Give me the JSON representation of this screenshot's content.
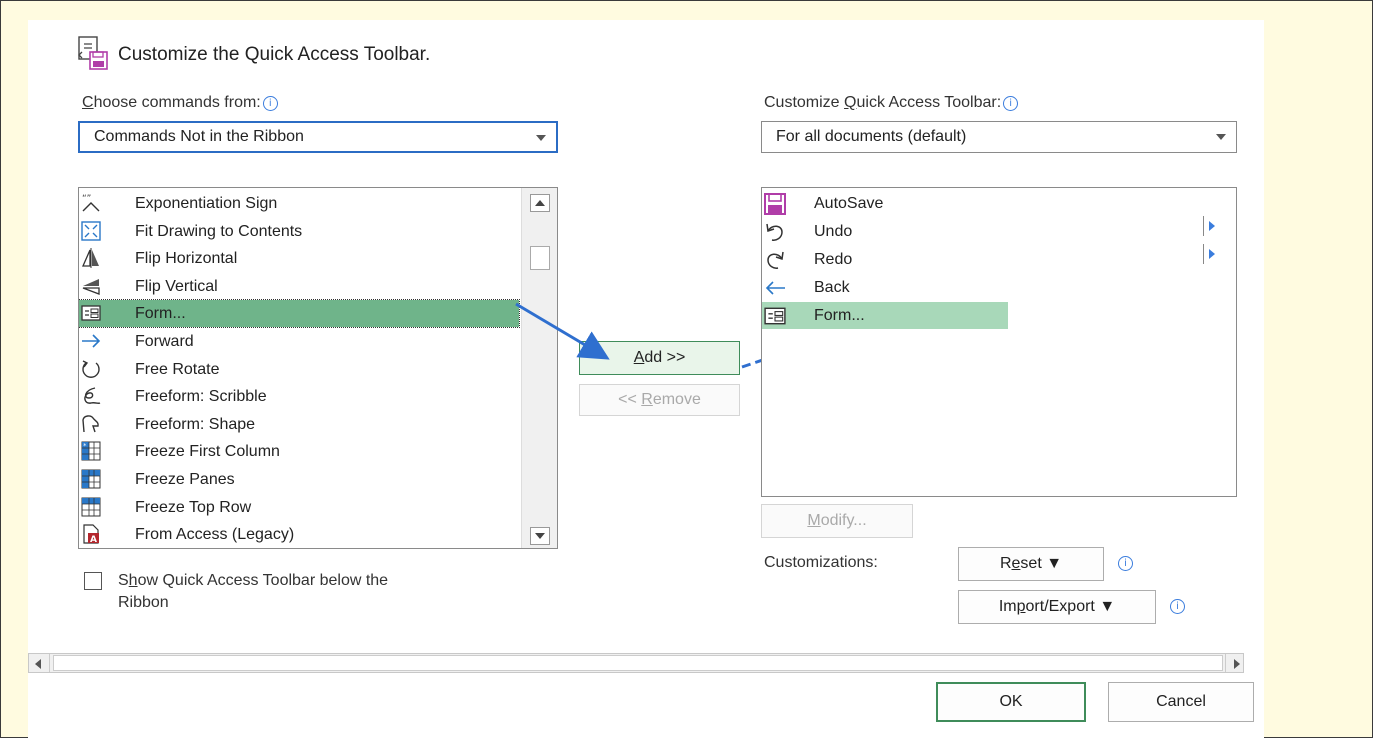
{
  "title": "Customize the Quick Access Toolbar.",
  "left": {
    "label_pre": "",
    "label_u": "C",
    "label_post": "hoose commands from:",
    "dropdown_value": "Commands Not in the Ribbon",
    "items": [
      {
        "label": "Exponentiation Sign",
        "icon": "exponent-icon"
      },
      {
        "label": "Fit Drawing to Contents",
        "icon": "fit-drawing-icon"
      },
      {
        "label": "Flip Horizontal",
        "icon": "flip-horizontal-icon"
      },
      {
        "label": "Flip Vertical",
        "icon": "flip-vertical-icon"
      },
      {
        "label": "Form...",
        "icon": "form-icon"
      },
      {
        "label": "Forward",
        "icon": "forward-arrow-icon"
      },
      {
        "label": "Free Rotate",
        "icon": "rotate-icon"
      },
      {
        "label": "Freeform: Scribble",
        "icon": "scribble-icon"
      },
      {
        "label": "Freeform: Shape",
        "icon": "freeform-shape-icon"
      },
      {
        "label": "Freeze First Column",
        "icon": "freeze-column-icon"
      },
      {
        "label": "Freeze Panes",
        "icon": "freeze-panes-icon"
      },
      {
        "label": "Freeze Top Row",
        "icon": "freeze-row-icon"
      },
      {
        "label": "From Access (Legacy)",
        "icon": "access-icon"
      }
    ],
    "selected_index": 4,
    "checkbox_line1_pre": "S",
    "checkbox_line1_u": "h",
    "checkbox_line1_post": "ow Quick Access Toolbar below the",
    "checkbox_line2": "Ribbon"
  },
  "middle": {
    "add_u": "A",
    "add_post": "dd >>",
    "remove_pre": "<< ",
    "remove_u": "R",
    "remove_post": "emove"
  },
  "right": {
    "label_pre": "Customize ",
    "label_u": "Q",
    "label_post": "uick Access Toolbar:",
    "dropdown_value": "For all documents (default)",
    "items": [
      {
        "label": "AutoSave",
        "icon": "save-icon"
      },
      {
        "label": "Undo",
        "icon": "undo-icon"
      },
      {
        "label": "Redo",
        "icon": "redo-icon"
      },
      {
        "label": "Back",
        "icon": "back-arrow-icon"
      },
      {
        "label": "Form...",
        "icon": "form-icon"
      }
    ],
    "selected_index": 4,
    "modify_u": "M",
    "modify_post": "odify...",
    "customizations_label": "Customizations:",
    "reset_pre": "R",
    "reset_u": "e",
    "reset_post": "set",
    "import_pre": "Im",
    "import_u": "p",
    "import_post": "ort/Export"
  },
  "footer": {
    "ok": "OK",
    "cancel": "Cancel"
  },
  "colors": {
    "page_bg": "#fffbe0",
    "selection_left": "#6fb48a",
    "selection_right": "#a8d8b9",
    "focus_border": "#2b6cc4",
    "arrow": "#2f6fcf"
  }
}
